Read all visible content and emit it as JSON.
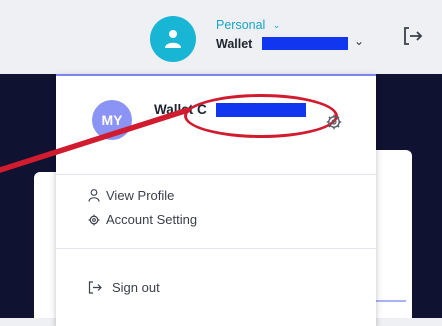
{
  "header": {
    "account_type": "Personal",
    "wallet_label": "Wallet",
    "avatar_icon": "user-icon",
    "dropdown_icon": "chevron-down-icon",
    "logout_icon": "logout-icon"
  },
  "dropdown": {
    "avatar_initials": "MY",
    "profile_name": "Wallet C",
    "settings_icon": "gear-icon",
    "items": [
      {
        "label": "View Profile",
        "icon": "user-icon"
      },
      {
        "label": "Account Setting",
        "icon": "gear-icon"
      }
    ],
    "sign_out": {
      "label": "Sign out",
      "icon": "logout-icon"
    }
  },
  "colors": {
    "accent": "#19b5d4",
    "avatar_purple": "#8b93f5",
    "redaction": "#1136f0",
    "annotation_red": "#d11b2e",
    "dark_bg": "#0f1230"
  }
}
